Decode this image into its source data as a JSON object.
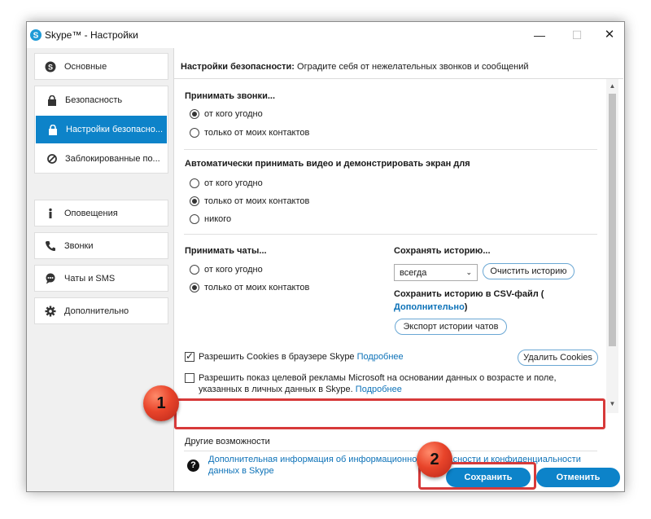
{
  "window": {
    "title": "Skype™ - Настройки"
  },
  "sidebar": {
    "items": [
      {
        "label": "Основные",
        "icon": "skype-icon"
      },
      {
        "label": "Безопасность",
        "icon": "lock-icon"
      },
      {
        "label": "Настройки безопасно...",
        "icon": "lock-icon",
        "active": true
      },
      {
        "label": "Заблокированные по...",
        "icon": "block-icon"
      },
      {
        "label": "Оповещения",
        "icon": "info-icon"
      },
      {
        "label": "Звонки",
        "icon": "phone-icon"
      },
      {
        "label": "Чаты и SMS",
        "icon": "chat-icon"
      },
      {
        "label": "Дополнительно",
        "icon": "gear-icon"
      }
    ]
  },
  "main": {
    "heading_bold": "Настройки безопасности:",
    "heading_rest": " Оградите себя от нежелательных звонков и сообщений",
    "calls": {
      "title": "Принимать звонки...",
      "options": [
        "от кого угодно",
        "только от моих контактов"
      ],
      "selected": 0
    },
    "video": {
      "title": "Автоматически принимать видео и демонстрировать экран для",
      "options": [
        "от кого угодно",
        "только от моих контактов",
        "никого"
      ],
      "selected": 1
    },
    "chats": {
      "title": "Принимать чаты...",
      "options": [
        "от кого угодно",
        "только от моих контактов"
      ],
      "selected": 1
    },
    "history": {
      "title": "Сохранять историю...",
      "value": "всегда",
      "clear_label": "Очистить историю",
      "csv_title": "Сохранить историю в CSV-файл (",
      "csv_link": "Дополнительно",
      "csv_close": ")",
      "export_label": "Экспорт истории чатов"
    },
    "cookies": {
      "label": "Разрешить Cookies в браузере Skype",
      "link": "Подробнее",
      "checked": true,
      "delete_label": "Удалить Cookies"
    },
    "ads": {
      "label": "Разрешить показ целевой рекламы Microsoft на основании данных о возрасте и поле, указанных в личных данных в Skype.",
      "link": "Подробнее",
      "checked": false
    },
    "other": {
      "title": "Другие возможности",
      "info_link": "Дополнительная информация об информационной безопасности и конфиденциальности данных в Skype"
    }
  },
  "buttons": {
    "save": "Сохранить",
    "cancel": "Отменить"
  },
  "badges": {
    "one": "1",
    "two": "2"
  },
  "colors": {
    "accent": "#0d83c9",
    "highlight": "#d73a3a",
    "link": "#0d72b8"
  }
}
